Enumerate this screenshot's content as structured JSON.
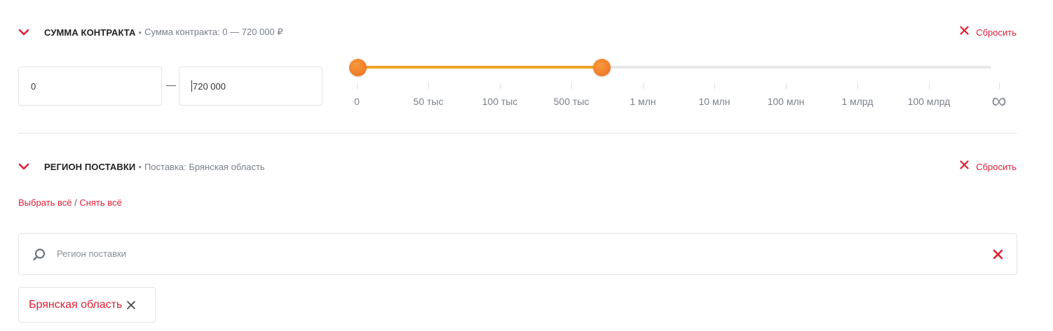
{
  "contract_sum": {
    "title": "СУММА КОНТРАКТА",
    "separator": "•",
    "summary": "Сумма контракта: 0 — 720 000 ₽",
    "reset_label": "Сбросить",
    "min_value": "0",
    "max_value": "720 000",
    "range_dash": "—",
    "slider": {
      "min_position": 0,
      "max_position": 0.385,
      "ticks": [
        "0",
        "50 тыс",
        "100 тыс",
        "500 тыс",
        "1 млн",
        "10 млн",
        "100 млн",
        "1 млрд",
        "100 млрд"
      ],
      "infinity_symbol": "∞"
    }
  },
  "region": {
    "title": "РЕГИОН ПОСТАВКИ",
    "separator": "•",
    "summary": "Поставка: Брянская область",
    "reset_label": "Сбросить",
    "select_all": "Выбрать всё",
    "links_separator": " / ",
    "deselect_all": "Снять всё",
    "search_placeholder": "Регион поставки",
    "selected_chips": [
      "Брянская область"
    ]
  },
  "colors": {
    "accent": "#e01e35",
    "slider_fill": "#f0a326",
    "slider_knob": "#ed6c1f"
  },
  "icons": {
    "collapse": "chevron-down-icon",
    "reset": "close-icon",
    "search": "search-icon",
    "clear": "close-icon"
  }
}
